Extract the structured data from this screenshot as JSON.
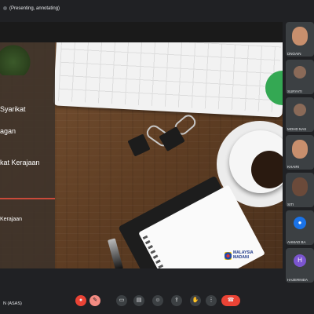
{
  "header": {
    "presenter_label": "(Presenting, annotating)"
  },
  "slide": {
    "lines": [
      "Syarikat",
      "agan",
      "kat Kerajaan",
      "Kerajaan"
    ],
    "logo_line1": "MALAYSIA",
    "logo_line2": "MADANI"
  },
  "participants": [
    {
      "name": "DNOAIN"
    },
    {
      "name": "SURYATI"
    },
    {
      "name": "MOHD NAS"
    },
    {
      "name": "KHAIRI"
    },
    {
      "name": "SITI"
    },
    {
      "name": "AHMAD BA"
    },
    {
      "name": "HAZERINDA"
    }
  ],
  "footer": {
    "meeting_name": "N (ASAS)"
  },
  "controls": [
    {
      "name": "mic-off-icon",
      "glyph": "●"
    },
    {
      "name": "annotate-icon",
      "glyph": "✎"
    },
    {
      "name": "camera-icon",
      "glyph": "▭"
    },
    {
      "name": "captions-icon",
      "glyph": "▤"
    },
    {
      "name": "emoji-icon",
      "glyph": "☺"
    },
    {
      "name": "present-icon",
      "glyph": "⇪"
    },
    {
      "name": "raise-hand-icon",
      "glyph": "✋"
    },
    {
      "name": "more-icon",
      "glyph": "⋮"
    },
    {
      "name": "end-call-icon",
      "glyph": "☎"
    }
  ],
  "colors": {
    "background": "#202124",
    "end_call": "#ea4335",
    "accent_green": "#34a853"
  }
}
